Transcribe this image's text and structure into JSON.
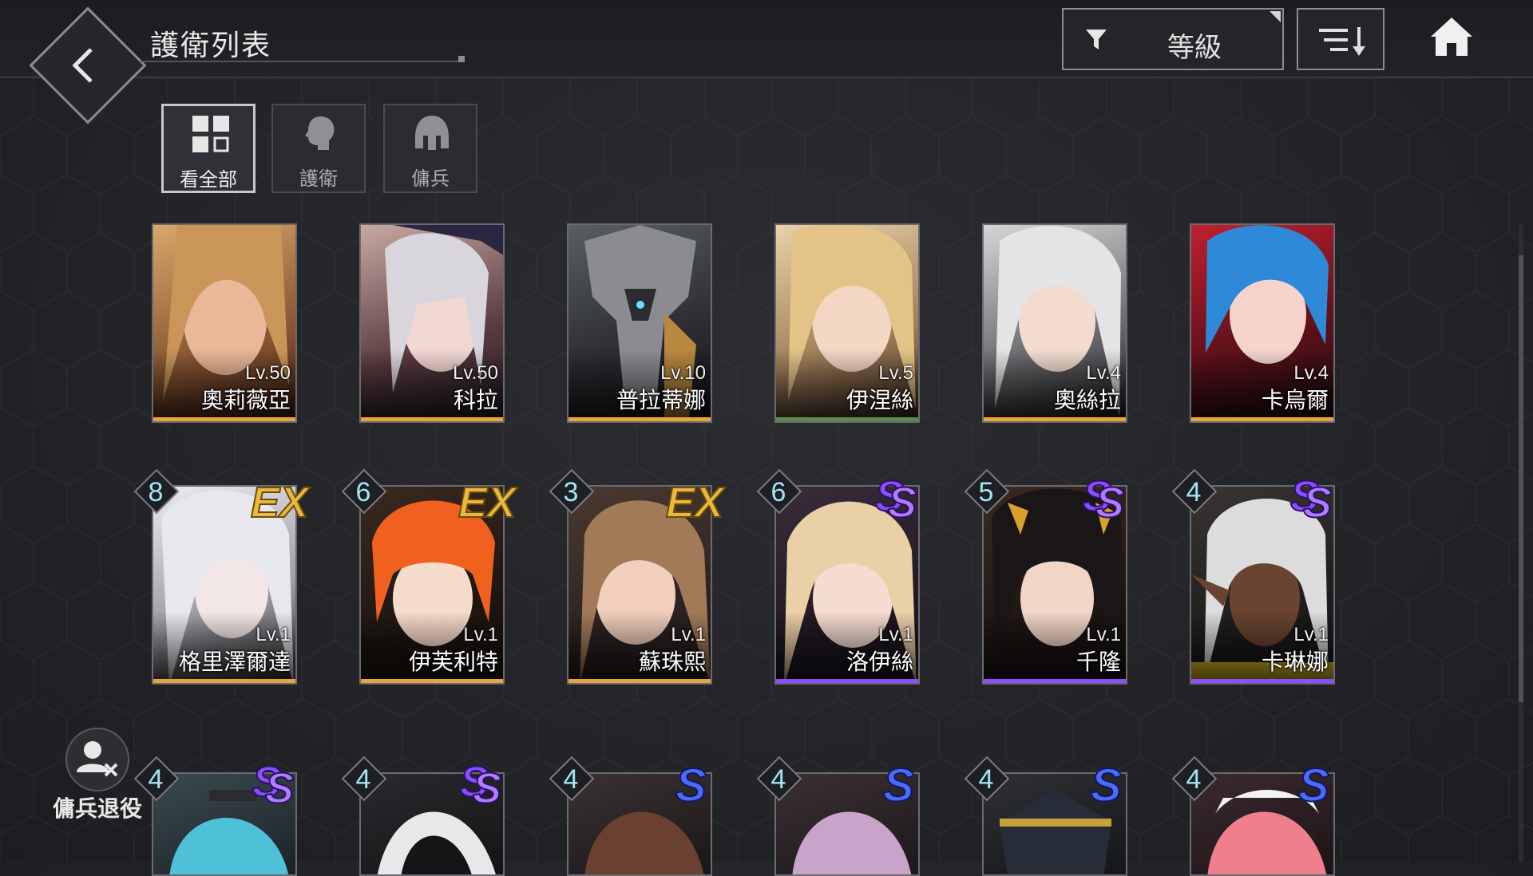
{
  "header": {
    "title": "護衛列表",
    "filter_label": "等級"
  },
  "icons": {
    "back": "back-arrow-icon",
    "filter": "funnel-icon",
    "sort": "sort-descending-icon",
    "home": "home-icon",
    "retire": "user-remove-icon"
  },
  "tabs": [
    {
      "label": "看全部",
      "icon": "grid-icon",
      "active": true
    },
    {
      "label": "護衛",
      "icon": "head-icon",
      "active": false
    },
    {
      "label": "傭兵",
      "icon": "helmet-icon",
      "active": false
    }
  ],
  "colors": {
    "ex_rank": "#e8b93a",
    "ss_rank": "#8a4dff",
    "s_rank": "#4b6bff",
    "star_number": "#9fe6f2"
  },
  "row1": [
    {
      "level": "Lv.50",
      "name": "奧莉薇亞"
    },
    {
      "level": "Lv.50",
      "name": "科拉"
    },
    {
      "level": "Lv.10",
      "name": "普拉蒂娜"
    },
    {
      "level": "Lv.5",
      "name": "伊涅絲"
    },
    {
      "level": "Lv.4",
      "name": "奧絲拉"
    },
    {
      "level": "Lv.4",
      "name": "卡烏爾"
    }
  ],
  "row2": [
    {
      "stars": "8",
      "rank": "EX",
      "level": "Lv.1",
      "name": "格里澤爾達"
    },
    {
      "stars": "6",
      "rank": "EX",
      "level": "Lv.1",
      "name": "伊芙利特"
    },
    {
      "stars": "3",
      "rank": "EX",
      "level": "Lv.1",
      "name": "蘇珠熙"
    },
    {
      "stars": "6",
      "rank": "SS",
      "level": "Lv.1",
      "name": "洛伊絲"
    },
    {
      "stars": "5",
      "rank": "SS",
      "level": "Lv.1",
      "name": "千隆"
    },
    {
      "stars": "4",
      "rank": "SS",
      "level": "Lv.1",
      "name": "卡琳娜"
    }
  ],
  "row3": [
    {
      "stars": "4",
      "rank": "SS"
    },
    {
      "stars": "4",
      "rank": "SS"
    },
    {
      "stars": "4",
      "rank": "S"
    },
    {
      "stars": "4",
      "rank": "S"
    },
    {
      "stars": "4",
      "rank": "S"
    },
    {
      "stars": "4",
      "rank": "S"
    }
  ],
  "retire": {
    "label": "傭兵退役"
  }
}
